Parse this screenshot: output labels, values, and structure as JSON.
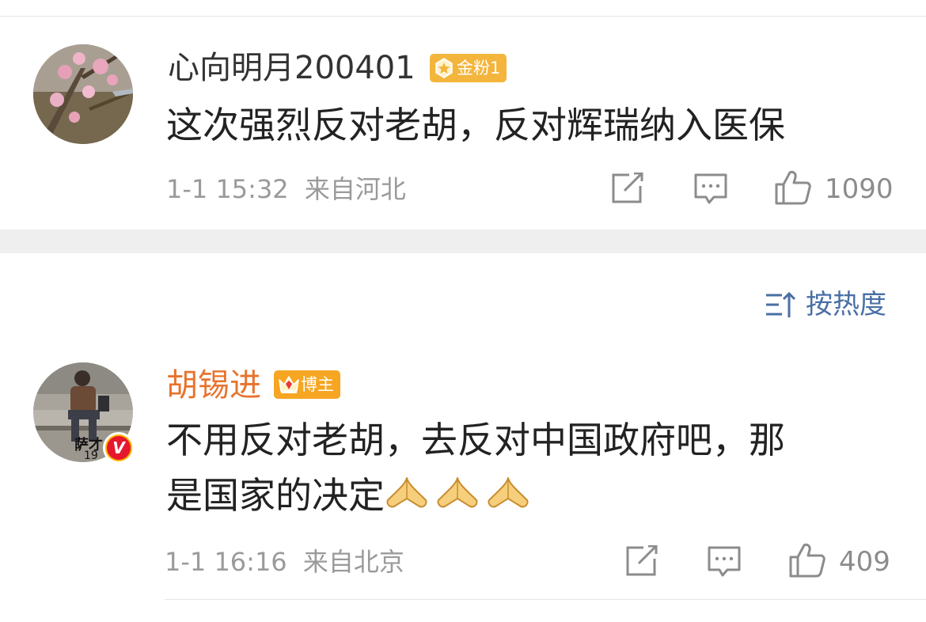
{
  "comments": [
    {
      "username": "心向明月200401",
      "badge_label": "金粉1",
      "badge_icon": "gold-fan-icon",
      "content_lines": [
        "这次强烈反对老胡，反对辉瑞纳入医保"
      ],
      "timestamp": "1-1 15:32",
      "location": "来自河北",
      "likes": "1090",
      "username_color": "#333333",
      "badge_color": "#f3b53b"
    },
    {
      "username": "胡锡进",
      "badge_label": "博主",
      "badge_icon": "crown-icon",
      "avatar_caption": "萨才",
      "avatar_caption2": "19",
      "content_lines": [
        "不用反对老胡，去反对中国政府吧，那",
        "是国家的决定"
      ],
      "content_emoji": [
        "folded-hands-emoji",
        "folded-hands-emoji",
        "folded-hands-emoji"
      ],
      "timestamp": "1-1 16:16",
      "location": "来自北京",
      "likes": "409",
      "username_color": "#e8732c",
      "badge_color": "#f6a623",
      "verified": true
    }
  ],
  "sort": {
    "label": "按热度",
    "icon": "sort-icon",
    "color": "#4a6fa5"
  },
  "actions": {
    "share_icon": "share-icon",
    "comment_icon": "comment-icon",
    "like_icon": "thumbs-up-icon"
  }
}
